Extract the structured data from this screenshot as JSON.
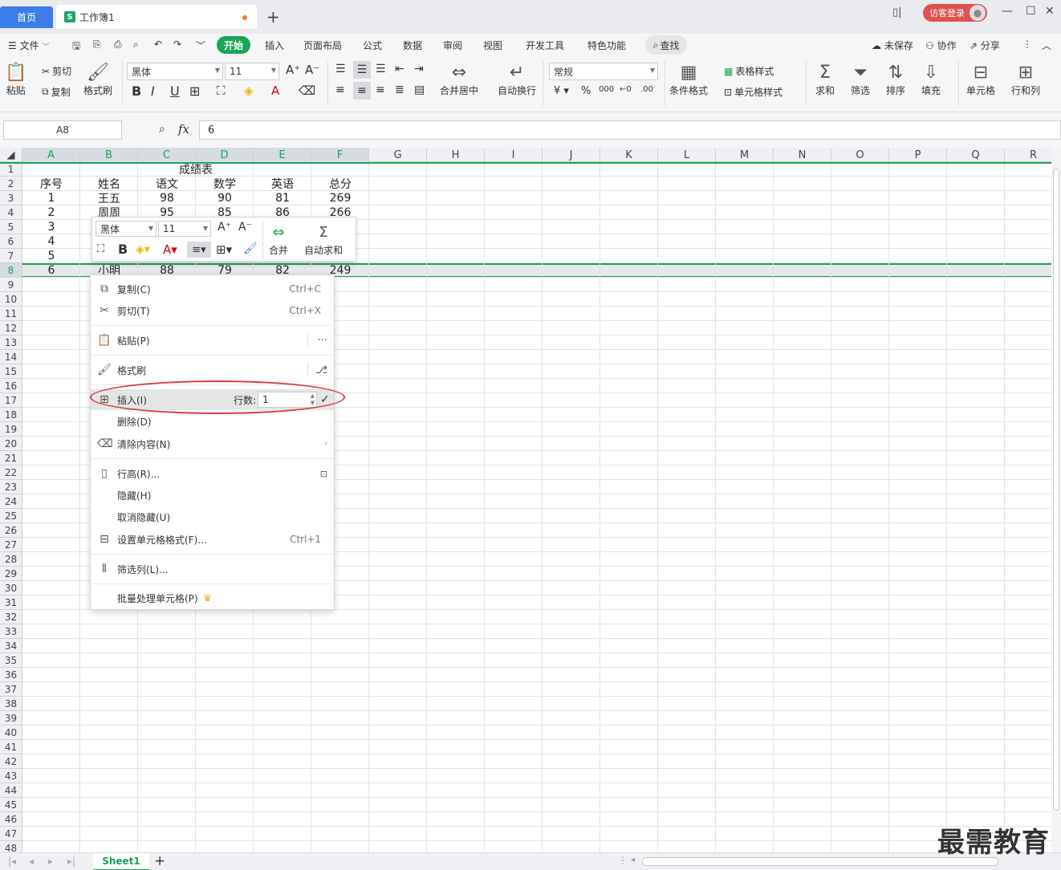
{
  "titlebar": {
    "home_tab": "首页",
    "workbook_tab": "工作簿1",
    "login_button": "访客登录"
  },
  "menubar": {
    "items": [
      "三 文件",
      "开始",
      "插入",
      "页面布局",
      "公式",
      "数据",
      "审阅",
      "视图",
      "开发工具",
      "特色功能",
      "查找"
    ],
    "file": "文件",
    "active": "开始",
    "insert": "插入",
    "page_layout": "页面布局",
    "formula": "公式",
    "data": "数据",
    "review": "审阅",
    "view": "视图",
    "developer": "开发工具",
    "special": "特色功能",
    "search": "查找",
    "unsaved": "未保存",
    "collab": "协作",
    "share": "分享"
  },
  "ribbon": {
    "paste": "粘贴",
    "cut": "剪切",
    "copy": "复制",
    "format_painter": "格式刷",
    "font_name": "黑体",
    "font_size": "11",
    "merge_center": "合并居中",
    "auto_wrap": "自动换行",
    "number_format": "常规",
    "conditional_format": "条件格式",
    "table_style": "表格样式",
    "cell_style": "单元格样式",
    "sum": "求和",
    "filter": "筛选",
    "sort": "排序",
    "fill": "填充",
    "cell": "单元格",
    "row_col": "行和列"
  },
  "formulabar": {
    "name_box": "A8",
    "fx": "fx",
    "value": "6"
  },
  "grid": {
    "columns": [
      "A",
      "B",
      "C",
      "D",
      "E",
      "F",
      "G",
      "H",
      "I",
      "J",
      "K",
      "L",
      "M",
      "N",
      "O",
      "P",
      "Q",
      "R"
    ],
    "title": "成绩表",
    "headers": [
      "序号",
      "姓名",
      "语文",
      "数学",
      "英语",
      "总分"
    ],
    "rows": [
      [
        "1",
        "王五",
        "98",
        "90",
        "81",
        "269"
      ],
      [
        "2",
        "周周",
        "95",
        "85",
        "86",
        "266"
      ],
      [
        "3",
        "",
        "",
        "",
        "",
        ""
      ],
      [
        "4",
        "",
        "",
        "",
        "",
        ""
      ],
      [
        "5",
        "",
        "",
        "",
        "",
        ""
      ],
      [
        "6",
        "小明",
        "88",
        "79",
        "82",
        "249"
      ]
    ],
    "selected_row": "8"
  },
  "minitoolbar": {
    "font_name": "黑体",
    "font_size": "11",
    "merge": "合并",
    "autosum": "自动求和"
  },
  "context_menu": {
    "copy": "复制(C)",
    "copy_sc": "Ctrl+C",
    "cut": "剪切(T)",
    "cut_sc": "Ctrl+X",
    "paste": "粘贴(P)",
    "format_painter": "格式刷",
    "insert": "插入(I)",
    "row_count_label": "行数:",
    "row_count_value": "1",
    "delete": "删除(D)",
    "clear": "清除内容(N)",
    "row_height": "行高(R)...",
    "hide": "隐藏(H)",
    "unhide": "取消隐藏(U)",
    "cell_format": "设置单元格格式(F)...",
    "cell_format_sc": "Ctrl+1",
    "filter_col": "筛选列(L)...",
    "batch": "批量处理单元格(P)"
  },
  "bottombar": {
    "sheet": "Sheet1",
    "watermark": "最需教育"
  },
  "colors": {
    "accent_green": "#1ba456",
    "home_blue": "#3b7de9",
    "login_red": "#e05050",
    "highlight_ellipse": "#e03a3a"
  }
}
